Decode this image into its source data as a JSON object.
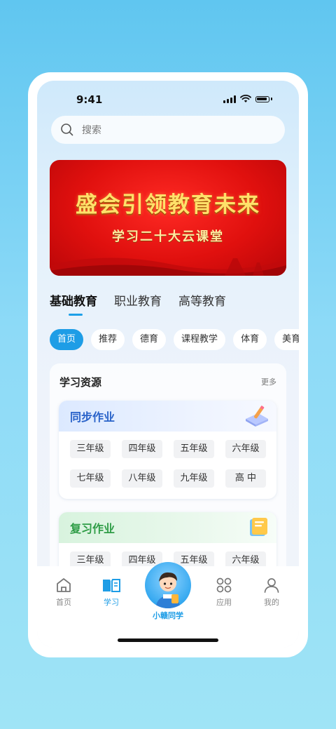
{
  "status_bar": {
    "time": "9:41"
  },
  "search": {
    "placeholder": "搜索",
    "icon": "search-icon"
  },
  "banner": {
    "title": "盛会引领教育未来",
    "subtitle": "学习二十大云课堂"
  },
  "main_tabs": [
    {
      "label": "基础教育",
      "active": true
    },
    {
      "label": "职业教育",
      "active": false
    },
    {
      "label": "高等教育",
      "active": false
    }
  ],
  "category_chips": [
    {
      "label": "首页",
      "active": true
    },
    {
      "label": "推荐"
    },
    {
      "label": "德育"
    },
    {
      "label": "课程教学"
    },
    {
      "label": "体育"
    },
    {
      "label": "美育"
    }
  ],
  "resources": {
    "title": "学习资源",
    "more": "更多",
    "sections": [
      {
        "title": "同步作业",
        "icon": "notebook-pencil-icon",
        "grades": [
          "三年级",
          "四年级",
          "五年级",
          "六年级",
          "七年级",
          "八年级",
          "九年级",
          "高 中"
        ]
      },
      {
        "title": "复习作业",
        "icon": "book-stack-icon",
        "grades": [
          "三年级",
          "四年级",
          "五年级",
          "六年级"
        ]
      }
    ]
  },
  "bottom_nav": {
    "items": [
      {
        "label": "首页",
        "icon": "home-icon",
        "active": false
      },
      {
        "label": "学习",
        "icon": "open-book-icon",
        "active": true
      },
      {
        "label": "小赣同学",
        "icon": "student-avatar",
        "active": false
      },
      {
        "label": "应用",
        "icon": "grid-apps-icon",
        "active": false
      },
      {
        "label": "我的",
        "icon": "person-icon",
        "active": false
      }
    ]
  },
  "colors": {
    "accent": "#1e9de6",
    "banner_red": "#e0100e",
    "banner_gold": "#ffe16a",
    "sync_title": "#2a63c9",
    "review_title": "#2f9d47"
  }
}
